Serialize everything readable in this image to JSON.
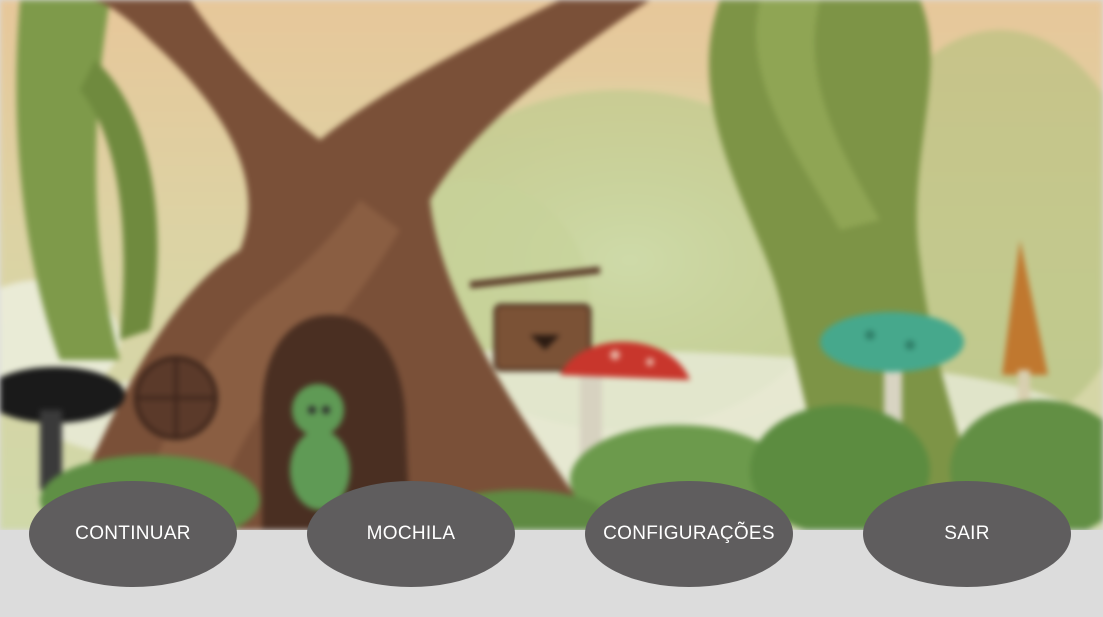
{
  "menu": {
    "continue_label": "CONTINUAR",
    "backpack_label": "MOCHILA",
    "settings_label": "CONFIGURAÇÕES",
    "exit_label": "SAIR"
  },
  "colors": {
    "button_bg": "#5f5d5e",
    "button_text": "#ffffff",
    "bar_bg": "#dcdcdc"
  }
}
